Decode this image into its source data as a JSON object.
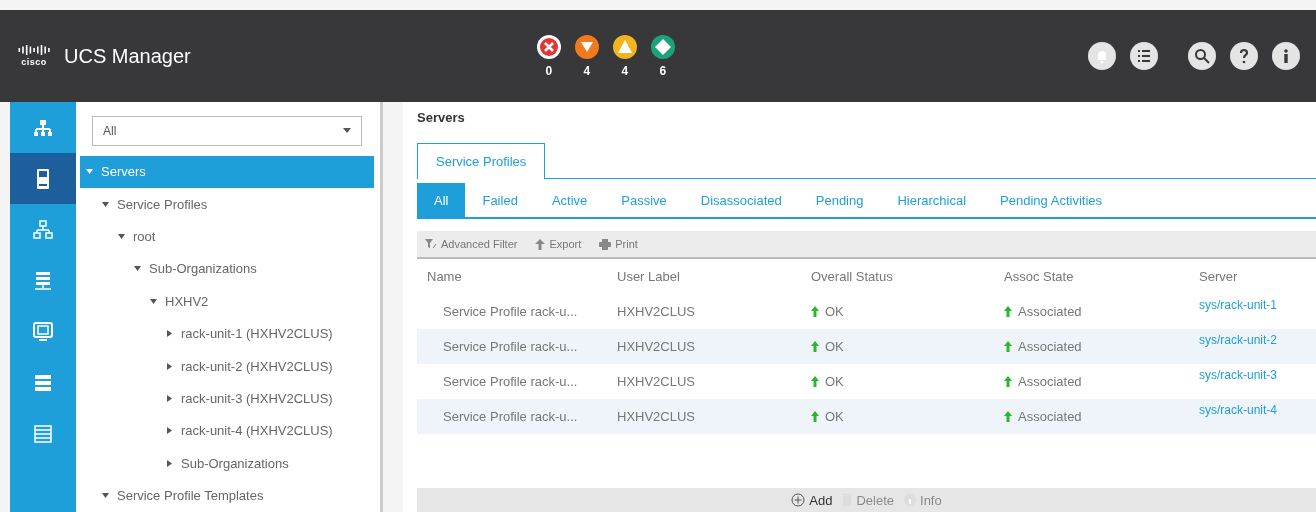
{
  "header": {
    "logo_text": "cisco",
    "brand": "UCS Manager",
    "alerts": [
      {
        "kind": "critical",
        "count": "0"
      },
      {
        "kind": "major",
        "count": "4"
      },
      {
        "kind": "minor",
        "count": "4"
      },
      {
        "kind": "warning",
        "count": "6"
      }
    ],
    "actions": [
      {
        "kind": "bell"
      },
      {
        "kind": "list"
      },
      {
        "kind": "search"
      },
      {
        "kind": "help"
      },
      {
        "kind": "info"
      }
    ]
  },
  "nav_rail": [
    {
      "kind": "equipment",
      "selected": false
    },
    {
      "kind": "server",
      "selected": true
    },
    {
      "kind": "network",
      "selected": false
    },
    {
      "kind": "storage",
      "selected": false
    },
    {
      "kind": "vm",
      "selected": false
    },
    {
      "kind": "stack",
      "selected": false
    },
    {
      "kind": "lines",
      "selected": false
    }
  ],
  "filter": {
    "value": "All"
  },
  "tree": [
    {
      "label": "Servers",
      "selected": true,
      "expanded": true,
      "children": [
        {
          "label": "Service Profiles",
          "selected": false,
          "expanded": true,
          "children": [
            {
              "label": "root",
              "selected": false,
              "expanded": true,
              "children": [
                {
                  "label": "Sub-Organizations",
                  "selected": false,
                  "expanded": true,
                  "children": [
                    {
                      "label": "HXHV2",
                      "selected": false,
                      "expanded": true,
                      "children": [
                        {
                          "label": "rack-unit-1 (HXHV2CLUS)",
                          "selected": false,
                          "expanded": false
                        },
                        {
                          "label": "rack-unit-2 (HXHV2CLUS)",
                          "selected": false,
                          "expanded": false
                        },
                        {
                          "label": "rack-unit-3 (HXHV2CLUS)",
                          "selected": false,
                          "expanded": false
                        },
                        {
                          "label": "rack-unit-4 (HXHV2CLUS)",
                          "selected": false,
                          "expanded": false
                        },
                        {
                          "label": "Sub-Organizations",
                          "selected": false,
                          "expanded": false
                        }
                      ]
                    }
                  ]
                }
              ]
            }
          ]
        },
        {
          "label": "Service Profile Templates",
          "selected": false,
          "expanded": true
        }
      ]
    }
  ],
  "main": {
    "title": "Servers",
    "tabs": [
      {
        "label": "Service Profiles",
        "selected": true
      }
    ],
    "subtabs": [
      {
        "label": "All",
        "selected": true
      },
      {
        "label": "Failed",
        "selected": false
      },
      {
        "label": "Active",
        "selected": false
      },
      {
        "label": "Passive",
        "selected": false
      },
      {
        "label": "Disassociated",
        "selected": false
      },
      {
        "label": "Pending",
        "selected": false
      },
      {
        "label": "Hierarchical",
        "selected": false
      },
      {
        "label": "Pending Activities",
        "selected": false
      }
    ],
    "toolbar": [
      {
        "kind": "filter",
        "label": "Advanced Filter"
      },
      {
        "kind": "export",
        "label": "Export"
      },
      {
        "kind": "print",
        "label": "Print"
      }
    ],
    "table": {
      "columns": [
        "Name",
        "User Label",
        "Overall Status",
        "Assoc State",
        "Server"
      ],
      "rows": [
        {
          "name": "Service Profile rack-u...",
          "user_label": "HXHV2CLUS",
          "overall_status": "OK",
          "assoc_state": "Associated",
          "server": "sys/rack-unit-1"
        },
        {
          "name": "Service Profile rack-u...",
          "user_label": "HXHV2CLUS",
          "overall_status": "OK",
          "assoc_state": "Associated",
          "server": "sys/rack-unit-2"
        },
        {
          "name": "Service Profile rack-u...",
          "user_label": "HXHV2CLUS",
          "overall_status": "OK",
          "assoc_state": "Associated",
          "server": "sys/rack-unit-3"
        },
        {
          "name": "Service Profile rack-u...",
          "user_label": "HXHV2CLUS",
          "overall_status": "OK",
          "assoc_state": "Associated",
          "server": "sys/rack-unit-4"
        }
      ]
    },
    "footer": [
      {
        "kind": "add",
        "label": "Add",
        "disabled": false
      },
      {
        "kind": "delete",
        "label": "Delete",
        "disabled": true
      },
      {
        "kind": "info",
        "label": "Info",
        "disabled": true
      }
    ]
  }
}
